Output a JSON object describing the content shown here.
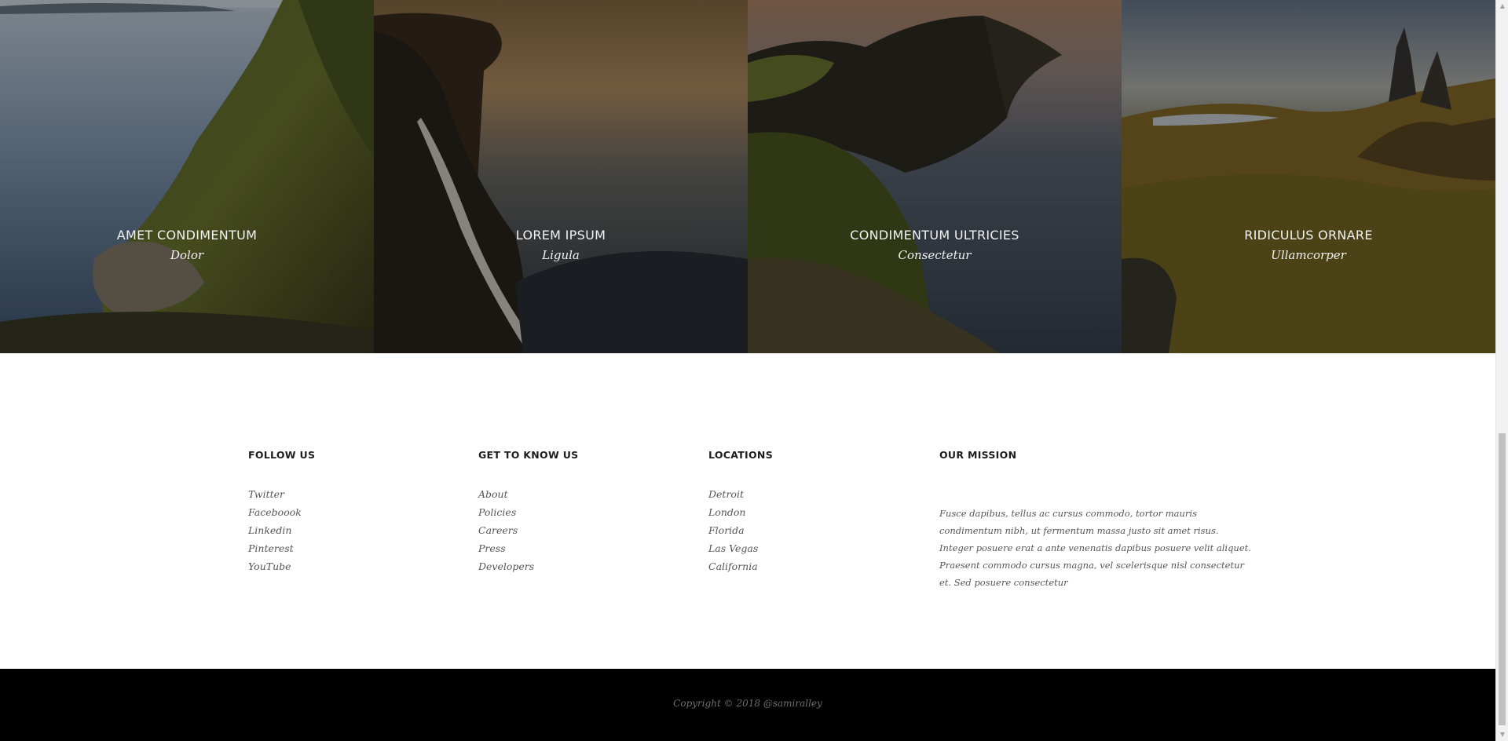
{
  "gallery": [
    {
      "title": "AMET CONDIMENTUM",
      "subtitle": "Dolor"
    },
    {
      "title": "LOREM IPSUM",
      "subtitle": "Ligula"
    },
    {
      "title": "CONDIMENTUM ULTRICIES",
      "subtitle": "Consectetur"
    },
    {
      "title": "RIDICULUS ORNARE",
      "subtitle": "Ullamcorper"
    }
  ],
  "footer": {
    "follow": {
      "heading": "FOLLOW US",
      "links": [
        "Twitter",
        "Faceboook",
        "Linkedin",
        "Pinterest",
        "YouTube"
      ]
    },
    "know": {
      "heading": "GET TO KNOW US",
      "links": [
        "About",
        "Policies",
        "Careers",
        "Press",
        "Developers"
      ]
    },
    "locations": {
      "heading": "LOCATIONS",
      "links": [
        "Detroit",
        "London",
        "Florida",
        "Las Vegas",
        "California"
      ]
    },
    "mission": {
      "heading": "OUR MISSION",
      "text": "Fusce dapibus, tellus ac cursus commodo, tortor mauris condimentum nibh, ut fermentum massa justo sit amet risus. Integer posuere erat a ante venenatis dapibus posuere velit aliquet. Praesent commodo cursus magna, vel scelerisque nisl consectetur et. Sed posuere consectetur"
    }
  },
  "copyright": "Copyright © 2018 @samiralley",
  "colors": {
    "footer_bg": "#ffffff",
    "copyright_bg": "#000000",
    "link_text": "#555555",
    "caption_text": "#f2f2f2"
  }
}
